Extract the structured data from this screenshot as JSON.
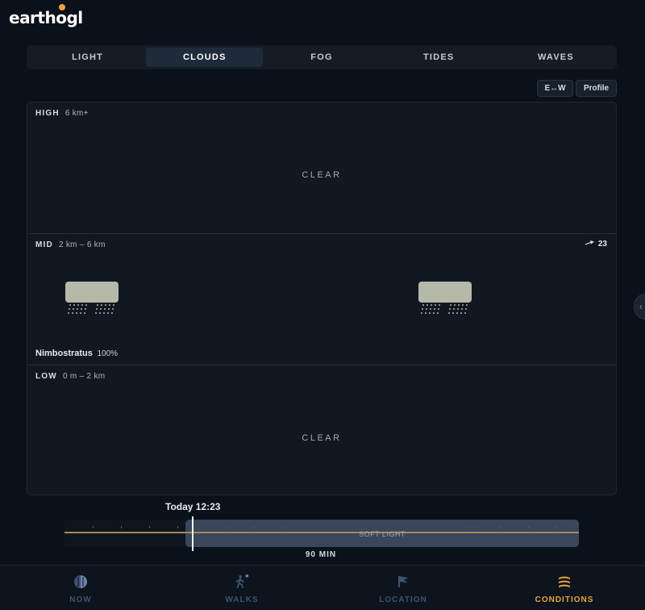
{
  "app": {
    "logo_text_before": "earth",
    "logo_sun_letter": "o",
    "logo_text_after": "gl"
  },
  "tabs": [
    {
      "label": "LIGHT",
      "active": false
    },
    {
      "label": "CLOUDS",
      "active": true
    },
    {
      "label": "FOG",
      "active": false
    },
    {
      "label": "TIDES",
      "active": false
    },
    {
      "label": "WAVES",
      "active": false
    }
  ],
  "view_buttons": {
    "direction": "E↔W",
    "profile": "Profile"
  },
  "layers": {
    "high": {
      "name": "HIGH",
      "range": "6 km+",
      "status": "CLEAR"
    },
    "mid": {
      "name": "MID",
      "range": "2 km – 6 km",
      "wind": "23",
      "cloud_type": "Nimbostratus",
      "coverage": "100%"
    },
    "low": {
      "name": "LOW",
      "range": "0 m – 2 km",
      "status": "CLEAR"
    }
  },
  "timeline": {
    "current_time": "Today 12:23",
    "band_label": "SOFT LIGHT",
    "duration": "90 MIN"
  },
  "bottom_nav": [
    {
      "label": "NOW",
      "icon": "moon-phase-icon",
      "active": false
    },
    {
      "label": "WALKS",
      "icon": "hiker-icon",
      "active": false
    },
    {
      "label": "LOCATION",
      "icon": "location-flag-icon",
      "active": false
    },
    {
      "label": "CONDITIONS",
      "icon": "conditions-layers-icon",
      "active": true
    }
  ],
  "colors": {
    "accent": "#e8a33a",
    "background": "#0b111a",
    "cloud": "#b6b8a9",
    "nav_inactive": "#3e5372"
  }
}
